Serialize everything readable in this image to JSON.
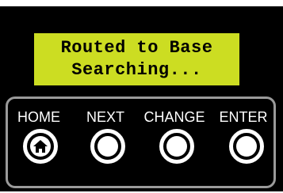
{
  "display": {
    "line1": "Routed to Base",
    "line2": "Searching..."
  },
  "keys": [
    {
      "label": "HOME",
      "icon": "home-icon"
    },
    {
      "label": "NEXT",
      "icon": "circle"
    },
    {
      "label": "CHANGE",
      "icon": "circle"
    },
    {
      "label": "ENTER",
      "icon": "circle"
    }
  ],
  "colors": {
    "lcd_background": "#ccdd22",
    "device_body": "#000000",
    "keypad_border": "#9a9a9a"
  }
}
